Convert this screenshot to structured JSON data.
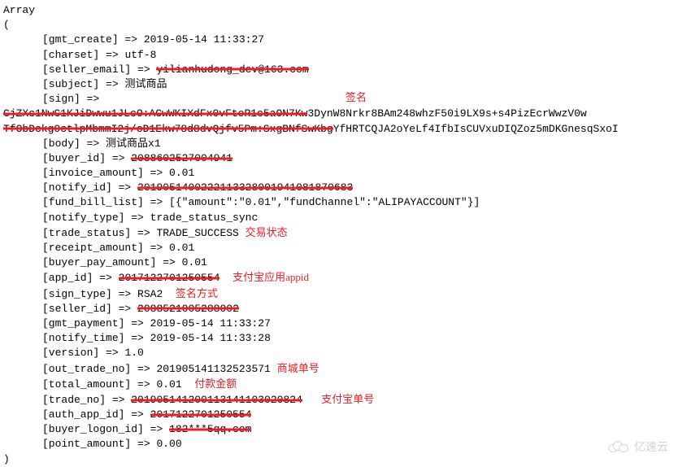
{
  "array_open": "Array",
  "paren_open": "(",
  "paren_close": ")",
  "arrow": " => ",
  "entries": {
    "gmt_create": {
      "key": "[gmt_create]",
      "value": "2019-05-14 11:33:27"
    },
    "charset": {
      "key": "[charset]",
      "value": "utf-8"
    },
    "seller_email": {
      "key": "[seller_email]",
      "value_redacted": "yilianhudong_dev@163.com"
    },
    "subject": {
      "key": "[subject]",
      "value": "测试商品"
    },
    "sign": {
      "key": "[sign]",
      "value_redacted_1": "CjZXc1NwC1KJiDwwu1JLcO:ACwWKIXdFx0vFtoR1c5aON7Kw",
      "value_visible_1": "3DynW8Nrkr8BAm248whzF50i9LX9s+s4PizEcrWwzV0w",
      "value_redacted_2": "TfObDckg0ctlpMbmmI2j/oD1Ekw78d8dvQjfv5Pm:SxgBNfSwKbg",
      "value_visible_2": "YfHRTCQJA2oYeLf4IfbIsCUVxuDIQZoz5mDKGnesqSxoI",
      "annotation": "签名"
    },
    "body": {
      "key": "[body]",
      "value": "测试商品x1"
    },
    "buyer_id": {
      "key": "[buyer_id]",
      "value_redacted": "2088602527004941"
    },
    "invoice_amount": {
      "key": "[invoice_amount]",
      "value": "0.01"
    },
    "notify_id": {
      "key": "[notify_id]",
      "value_redacted": "2019051400222113328001941081870683"
    },
    "fund_bill_list": {
      "key": "[fund_bill_list]",
      "value": "[{\"amount\":\"0.01\",\"fundChannel\":\"ALIPAYACCOUNT\"}]"
    },
    "notify_type": {
      "key": "[notify_type]",
      "value": "trade_status_sync"
    },
    "trade_status": {
      "key": "[trade_status]",
      "value": "TRADE_SUCCESS",
      "annotation": "交易状态"
    },
    "receipt_amount": {
      "key": "[receipt_amount]",
      "value": "0.01"
    },
    "buyer_pay_amount": {
      "key": "[buyer_pay_amount]",
      "value": "0.01"
    },
    "app_id": {
      "key": "[app_id]",
      "value_redacted": "2017122701250554",
      "annotation": "支付宝应用appid"
    },
    "sign_type": {
      "key": "[sign_type]",
      "value": "RSA2",
      "annotation": "签名方式"
    },
    "seller_id": {
      "key": "[seller_id]",
      "value_redacted": "2088521005288002"
    },
    "gmt_payment": {
      "key": "[gmt_payment]",
      "value": "2019-05-14 11:33:27"
    },
    "notify_time": {
      "key": "[notify_time]",
      "value": "2019-05-14 11:33:28"
    },
    "version": {
      "key": "[version]",
      "value": "1.0"
    },
    "out_trade_no": {
      "key": "[out_trade_no]",
      "value": "201905141132523571",
      "annotation": "商城单号"
    },
    "total_amount": {
      "key": "[total_amount]",
      "value": "0.01",
      "annotation": "付款金额"
    },
    "trade_no": {
      "key": "[trade_no]",
      "value_redacted": "201905141200113141103020824",
      "annotation": "支付宝单号"
    },
    "auth_app_id": {
      "key": "[auth_app_id]",
      "value_redacted": "2017122701250554"
    },
    "buyer_logon_id": {
      "key": "[buyer_logon_id]",
      "value_redacted": "182***5qq.com"
    },
    "point_amount": {
      "key": "[point_amount]",
      "value": "0.00"
    }
  },
  "watermark": "亿速云"
}
